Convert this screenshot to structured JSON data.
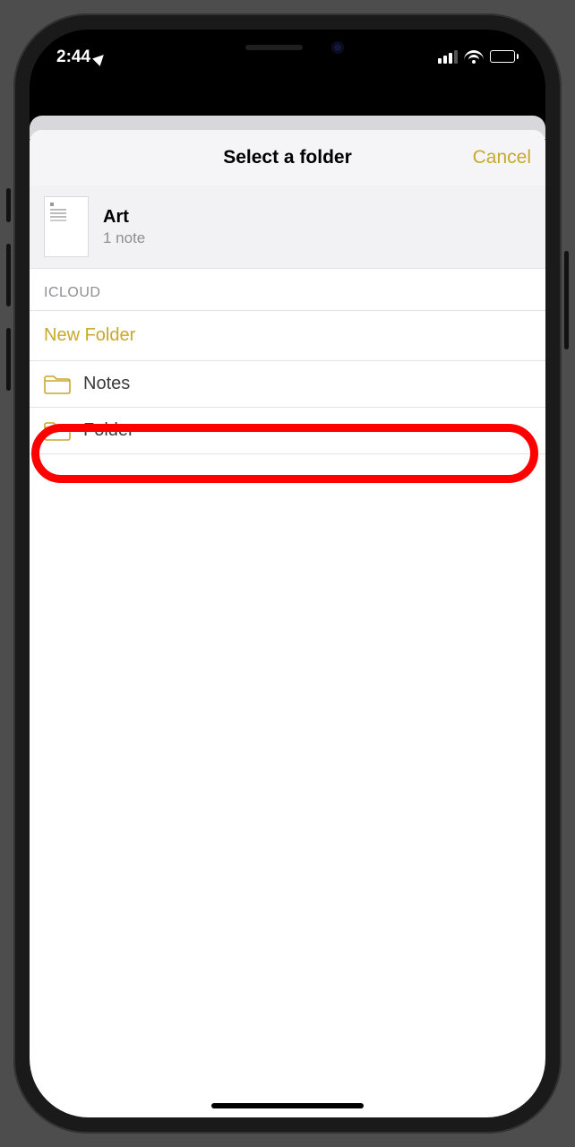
{
  "status": {
    "time": "2:44",
    "location_services": true
  },
  "modal": {
    "title": "Select a folder",
    "cancel_label": "Cancel"
  },
  "note": {
    "title": "Art",
    "count_label": "1 note"
  },
  "section": {
    "label": "ICLOUD"
  },
  "new_folder_label": "New Folder",
  "folders": [
    {
      "name": "Notes",
      "highlighted": true
    },
    {
      "name": "Folder",
      "highlighted": false
    }
  ],
  "colors": {
    "accent": "#c8a92c",
    "highlight": "#ff0000"
  }
}
